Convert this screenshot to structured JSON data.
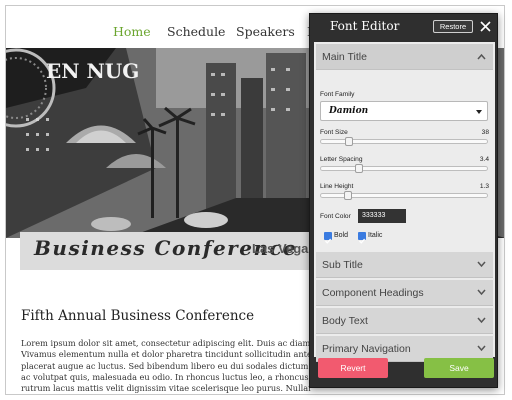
{
  "site": {
    "nav": {
      "home": "Home",
      "schedule": "Schedule",
      "speakers": "Speakers",
      "more": "L"
    },
    "hero": {
      "sign_text": "EN NUG"
    },
    "banner": {
      "script_title": "Business Conference",
      "tail": "Las Vegas,"
    },
    "content": {
      "heading": "Fifth Annual Business Conference",
      "body_lines": [
        "Lorem ipsum dolor sit amet, consectetur adipiscing elit. Duis ac diam",
        "Vivamus elementum nulla et dolor pharetra tincidunt sollicitudin ante",
        "placerat augue ac luctus. Sed bibendum libero eu dui sodales dictum",
        "ac volutpat quis, malesuada eu odio. In rhoncus luctus leo, a rhoncus",
        "rutrum lacus mattis velit dignissim vitae scelerisque leo purus. Nullam sed metus feugiat. Cum sociis"
      ]
    }
  },
  "editor": {
    "title": "Font Editor",
    "restore_label": "Restore",
    "sections": {
      "main_title": "Main Title",
      "sub_title": "Sub Title",
      "component_headings": "Component Headings",
      "body_text": "Body Text",
      "primary_navigation": "Primary Navigation"
    },
    "fields": {
      "font_family_label": "Font Family",
      "font_family_value": "Damion",
      "font_size_label": "Font Size",
      "font_size_value": "38",
      "letter_spacing_label": "Letter Spacing",
      "letter_spacing_value": "3.4",
      "line_height_label": "Line Height",
      "line_height_value": "1.3",
      "font_color_label": "Font Color",
      "font_color_value": "333333",
      "bold_label": "Bold",
      "italic_label": "Italic"
    },
    "sliders": {
      "font_size_fraction": 0.17,
      "letter_spacing_fraction": 0.23,
      "line_height_fraction": 0.16
    },
    "checkboxes": {
      "bold_checked": true,
      "italic_checked": true
    },
    "revert_label": "Revert",
    "save_label": "Save",
    "colors": {
      "accent_revert": "#f25a6f",
      "accent_save": "#86c045",
      "nav_active": "#6aa52e",
      "panel_dark": "#2f2f2f"
    },
    "icons": [
      "close-icon",
      "chevron-up-icon",
      "chevron-down-icon",
      "dropdown-caret-icon",
      "checkbox-checked-icon"
    ]
  }
}
